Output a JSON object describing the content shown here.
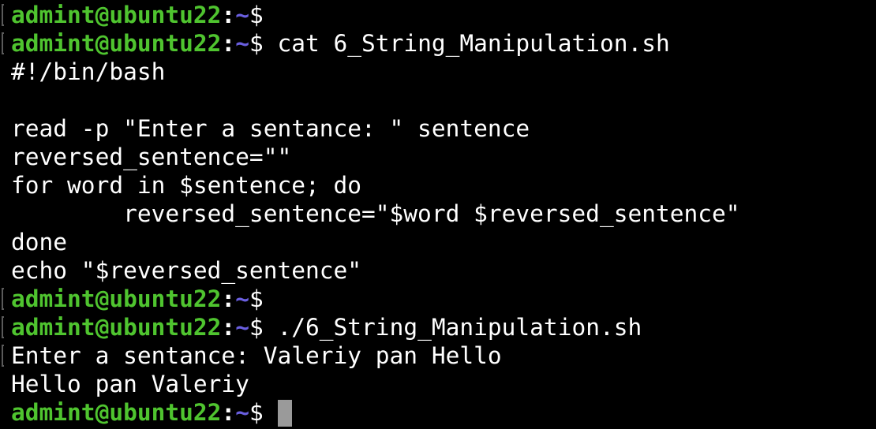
{
  "prompt": {
    "user_host": "admint@ubuntu22",
    "colon": ":",
    "path": "~",
    "symbol": "$"
  },
  "lines": [
    {
      "type": "prompt",
      "command": ""
    },
    {
      "type": "prompt",
      "command": "cat 6_String_Manipulation.sh"
    },
    {
      "type": "output",
      "text": "#!/bin/bash"
    },
    {
      "type": "output",
      "text": ""
    },
    {
      "type": "output",
      "text": "read -p \"Enter a sentance: \" sentence"
    },
    {
      "type": "output",
      "text": "reversed_sentence=\"\""
    },
    {
      "type": "output",
      "text": "for word in $sentence; do"
    },
    {
      "type": "output",
      "text": "        reversed_sentence=\"$word $reversed_sentence\""
    },
    {
      "type": "output",
      "text": "done"
    },
    {
      "type": "output",
      "text": "echo \"$reversed_sentence\""
    },
    {
      "type": "prompt",
      "command": ""
    },
    {
      "type": "prompt",
      "command": "./6_String_Manipulation.sh"
    },
    {
      "type": "output",
      "text": "Enter a sentance: Valeriy pan Hello",
      "marked": true
    },
    {
      "type": "output",
      "text": "Hello pan Valeriy"
    },
    {
      "type": "prompt",
      "command": "",
      "cursor": true,
      "unmarked": true
    }
  ],
  "colors": {
    "background": "#000000",
    "text": "#ffffff",
    "user_host": "#4fc42f",
    "path": "#6a5fe0",
    "cursor": "#9a9a9a"
  }
}
